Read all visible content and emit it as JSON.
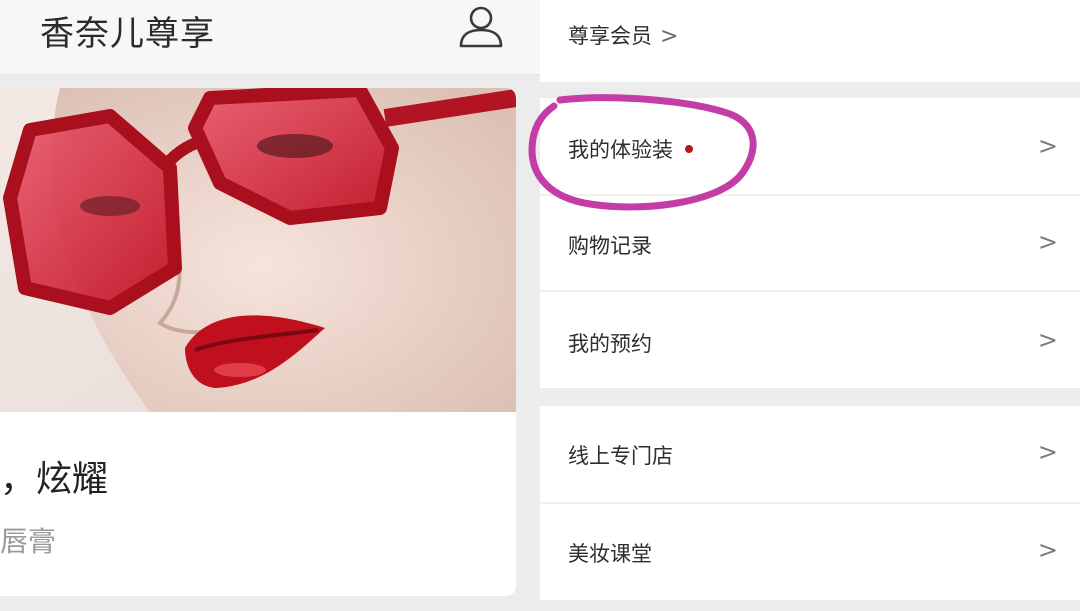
{
  "header": {
    "app_title": "香奈儿尊享",
    "user_icon": "user-outline-icon"
  },
  "promo": {
    "headline": "，炫耀",
    "subtext": "唇膏"
  },
  "menu": {
    "membership": {
      "label": "尊享会员",
      "chevron": ">"
    },
    "samples": {
      "label": "我的体验装",
      "chevron": ">",
      "has_notification_dot": true
    },
    "purchases": {
      "label": "购物记录",
      "chevron": ">"
    },
    "appointments": {
      "label": "我的预约",
      "chevron": ">"
    },
    "online_store": {
      "label": "线上专门店",
      "chevron": ">"
    },
    "beauty_class": {
      "label": "美妆课堂",
      "chevron": ">"
    }
  },
  "colors": {
    "accent_red": "#b4161b",
    "annotation_pink": "#c43da6"
  }
}
